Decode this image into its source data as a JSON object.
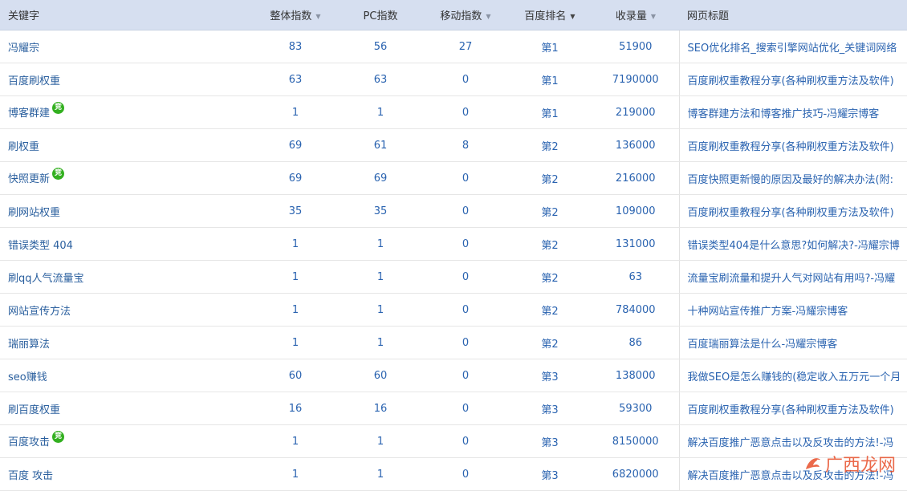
{
  "columns": [
    {
      "label": "关键字",
      "caret": ""
    },
    {
      "label": "整体指数",
      "caret": "▼"
    },
    {
      "label": "PC指数",
      "caret": ""
    },
    {
      "label": "移动指数",
      "caret": "▼"
    },
    {
      "label": "百度排名",
      "caret": "▼"
    },
    {
      "label": "收录量",
      "caret": "▼"
    },
    {
      "label": "网页标题",
      "caret": ""
    }
  ],
  "sort": {
    "active_column": "百度排名"
  },
  "rows": [
    {
      "keyword": "冯耀宗",
      "badge": "",
      "overall": "83",
      "pc": "56",
      "mobile": "27",
      "rank": "第1",
      "indexed": "51900",
      "title": "SEO优化排名_搜索引擎网站优化_关键词网络"
    },
    {
      "keyword": "百度刷权重",
      "badge": "",
      "overall": "63",
      "pc": "63",
      "mobile": "0",
      "rank": "第1",
      "indexed": "7190000",
      "title": "百度刷权重教程分享(各种刷权重方法及软件)"
    },
    {
      "keyword": "博客群建",
      "badge": "竞",
      "overall": "1",
      "pc": "1",
      "mobile": "0",
      "rank": "第1",
      "indexed": "219000",
      "title": "博客群建方法和博客推广技巧-冯耀宗博客"
    },
    {
      "keyword": "刷权重",
      "badge": "",
      "overall": "69",
      "pc": "61",
      "mobile": "8",
      "rank": "第2",
      "indexed": "136000",
      "title": "百度刷权重教程分享(各种刷权重方法及软件)"
    },
    {
      "keyword": "快照更新",
      "badge": "竞",
      "overall": "69",
      "pc": "69",
      "mobile": "0",
      "rank": "第2",
      "indexed": "216000",
      "title": "百度快照更新慢的原因及最好的解决办法(附:"
    },
    {
      "keyword": "刷网站权重",
      "badge": "",
      "overall": "35",
      "pc": "35",
      "mobile": "0",
      "rank": "第2",
      "indexed": "109000",
      "title": "百度刷权重教程分享(各种刷权重方法及软件)"
    },
    {
      "keyword": "错误类型 404",
      "badge": "",
      "overall": "1",
      "pc": "1",
      "mobile": "0",
      "rank": "第2",
      "indexed": "131000",
      "title": "错误类型404是什么意思?如何解决?-冯耀宗博"
    },
    {
      "keyword": "刷qq人气流量宝",
      "badge": "",
      "overall": "1",
      "pc": "1",
      "mobile": "0",
      "rank": "第2",
      "indexed": "63",
      "title": "流量宝刷流量和提升人气对网站有用吗?-冯耀"
    },
    {
      "keyword": "网站宣传方法",
      "badge": "",
      "overall": "1",
      "pc": "1",
      "mobile": "0",
      "rank": "第2",
      "indexed": "784000",
      "title": "十种网站宣传推广方案-冯耀宗博客"
    },
    {
      "keyword": "瑞丽算法",
      "badge": "",
      "overall": "1",
      "pc": "1",
      "mobile": "0",
      "rank": "第2",
      "indexed": "86",
      "title": "百度瑞丽算法是什么-冯耀宗博客"
    },
    {
      "keyword": "seo赚钱",
      "badge": "",
      "overall": "60",
      "pc": "60",
      "mobile": "0",
      "rank": "第3",
      "indexed": "138000",
      "title": "我做SEO是怎么赚钱的(稳定收入五万元一个月"
    },
    {
      "keyword": "刷百度权重",
      "badge": "",
      "overall": "16",
      "pc": "16",
      "mobile": "0",
      "rank": "第3",
      "indexed": "59300",
      "title": "百度刷权重教程分享(各种刷权重方法及软件)"
    },
    {
      "keyword": "百度攻击",
      "badge": "竞",
      "overall": "1",
      "pc": "1",
      "mobile": "0",
      "rank": "第3",
      "indexed": "8150000",
      "title": "解决百度推广恶意点击以及反攻击的方法!-冯"
    },
    {
      "keyword": "百度 攻击",
      "badge": "",
      "overall": "1",
      "pc": "1",
      "mobile": "0",
      "rank": "第3",
      "indexed": "6820000",
      "title": "解决百度推广恶意点击以及反攻击的方法!-冯"
    }
  ],
  "watermark": {
    "text": "广西龙网",
    "color": "#e8502b",
    "icon": "dragon-logo-icon"
  }
}
